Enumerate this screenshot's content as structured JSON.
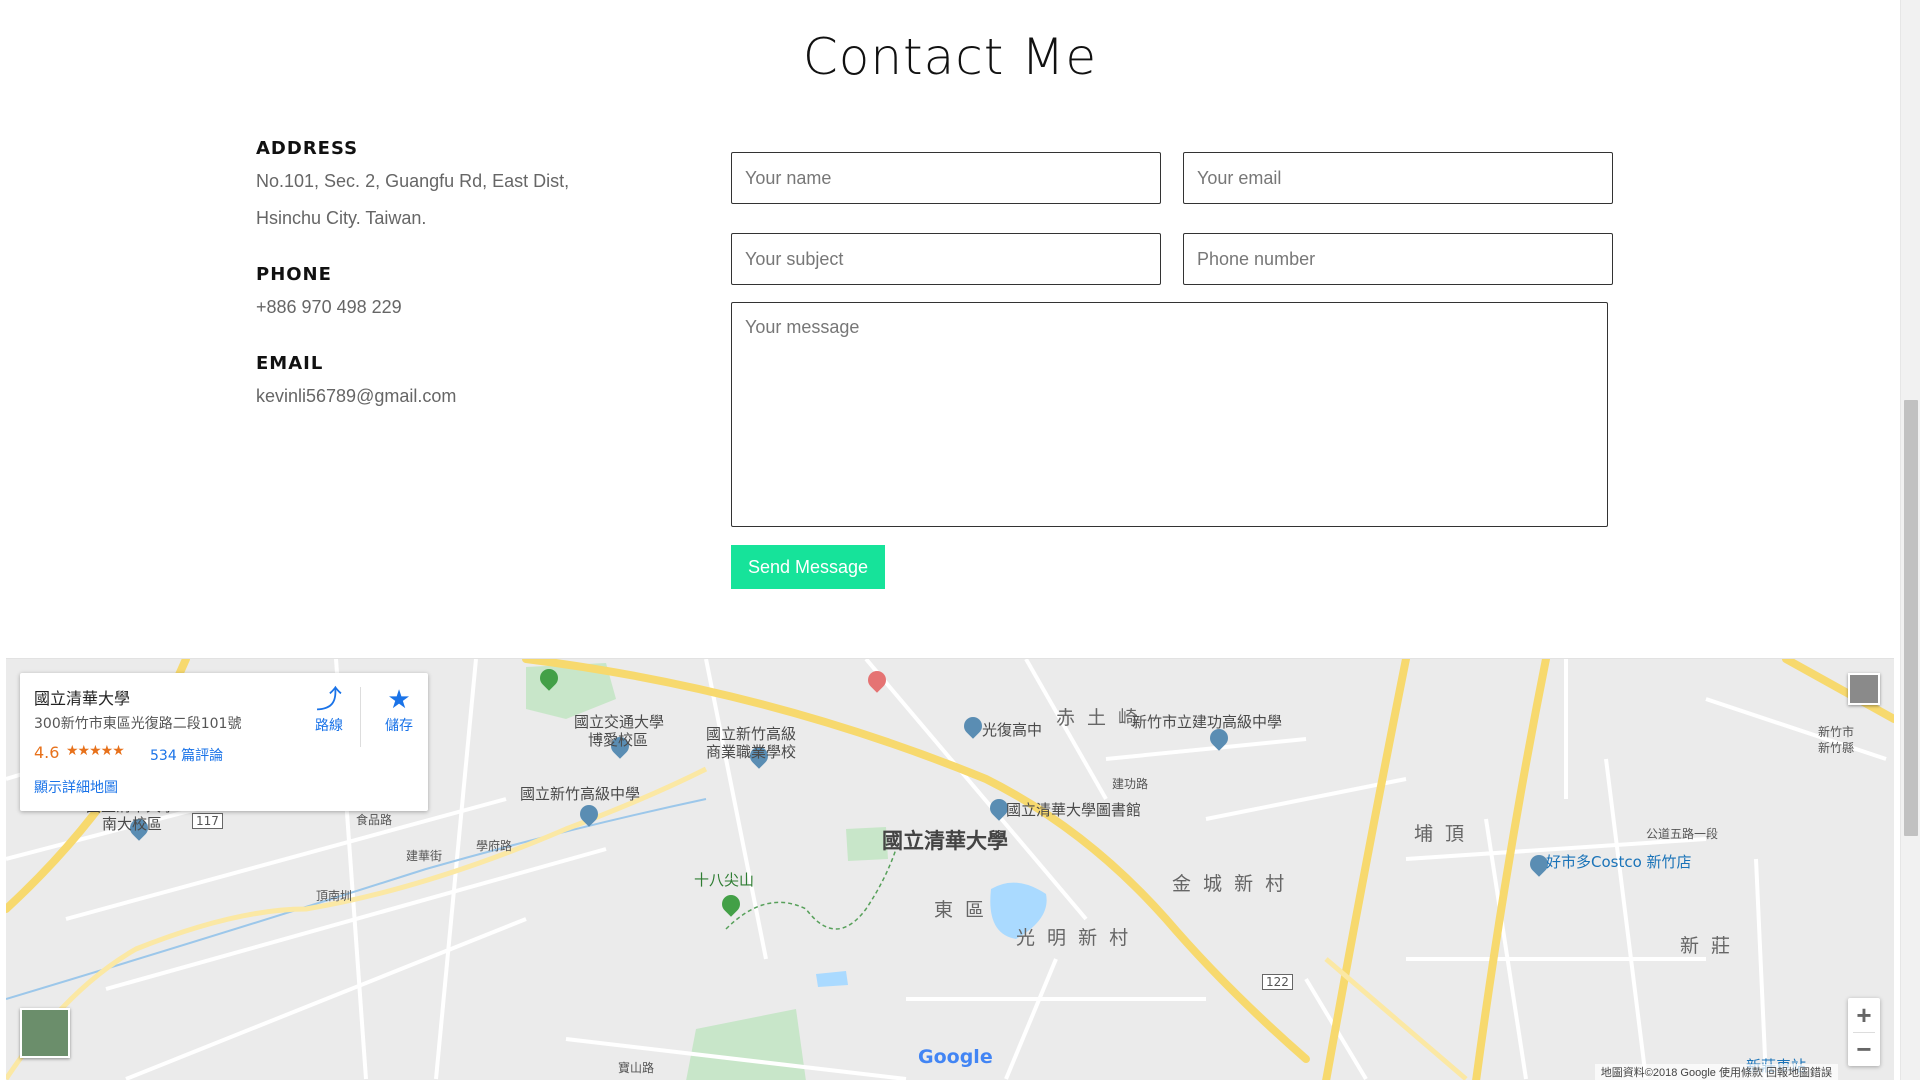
{
  "heading": "Contact Me",
  "contact": {
    "address_label": "ADDRESS",
    "address_line1": "No.101, Sec. 2, Guangfu Rd, East Dist,",
    "address_line2": "Hsinchu City. Taiwan.",
    "phone_label": "PHONE",
    "phone_value": "+886 970 498 229",
    "email_label": "EMAIL",
    "email_value": "kevinli56789@gmail.com"
  },
  "form": {
    "name_placeholder": "Your name",
    "email_placeholder": "Your email",
    "subject_placeholder": "Your subject",
    "phone_placeholder": "Phone number",
    "message_placeholder": "Your message",
    "send_label": "Send Message",
    "send_color": "#16e39a"
  },
  "map": {
    "place_name": "國立清華大學",
    "place_address": "300新竹市東區光復路二段101號",
    "rating": "4.6",
    "stars": "★★★★★",
    "reviews": "534 篇評論",
    "more_map": "顯示詳細地圖",
    "directions_label": "路線",
    "save_label": "儲存",
    "google_logo": "Google",
    "attribution": "地圖資料©2018 Google   使用條款   回報地圖錯誤",
    "zoom_in": "+",
    "zoom_out": "−",
    "labels": {
      "l1": "國立交通大學",
      "l2": "博愛校區",
      "l3": "國立新竹高級",
      "l4": "商業職業學校",
      "l5": "光復高中",
      "l6": "赤 土 崎",
      "l7": "新竹市立建功高級中學",
      "l8": "國立清華大學",
      "l9": "南大校區",
      "l10": "國立新竹高級中學",
      "l11": "國立清華大學圖書館",
      "l12": "國立清華大學",
      "l13": "十八尖山",
      "l14": "東 區",
      "l15": "光 明 新 村",
      "l16": "金 城 新 村",
      "l17": "埔 頂",
      "l18": "好市多Costco 新竹店",
      "l19": "新 莊",
      "l20": "建功路",
      "l21": "學府路",
      "l22": "食品路",
      "l23": "頂南圳",
      "l24": "公道五路一段",
      "l25": "建華街",
      "l26": "寶山路",
      "l27": "新莊車站",
      "l28": "新竹市",
      "l29": "新竹縣",
      "l30": "117",
      "l31": "122"
    }
  }
}
